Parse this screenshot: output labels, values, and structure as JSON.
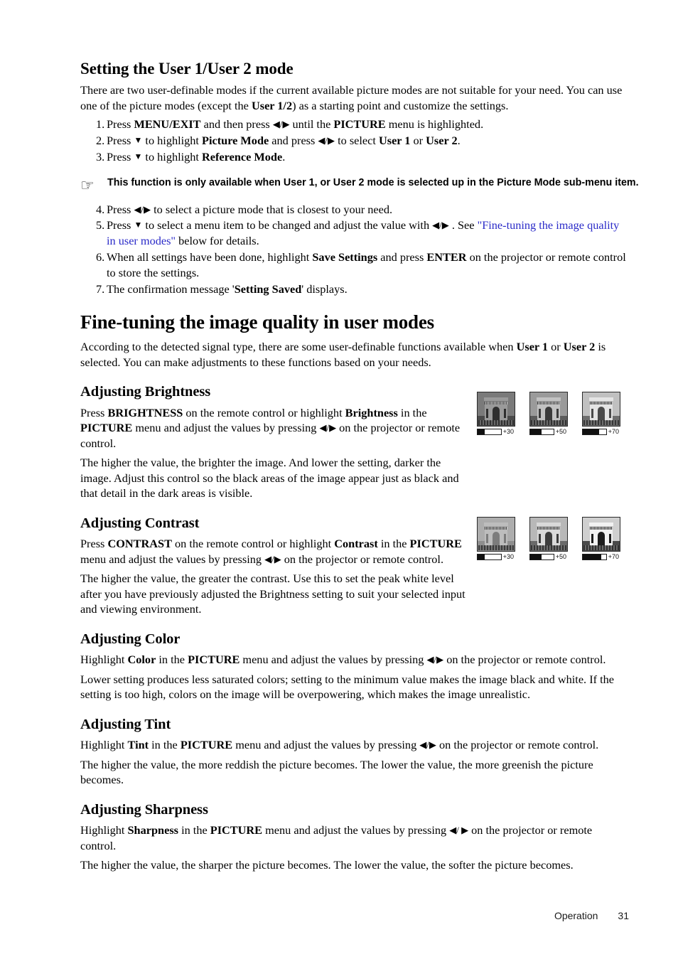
{
  "page": {
    "footer_label": "Operation",
    "footer_page_number": "31",
    "link_color": "#2a2ac8"
  },
  "section_user_mode": {
    "heading": "Setting the User 1/User 2 mode",
    "intro_part1": "There are two user-definable modes if the current available picture modes are not suitable for your need. You can use one of the picture modes (except the ",
    "intro_bold": "User 1/2",
    "intro_part2": ") as a starting point and customize the settings.",
    "steps": [
      {
        "num": "1.",
        "t1": "Press ",
        "b1": "MENU/EXIT",
        "t2": " and then press ",
        "arrows": "◀/▶",
        "t3": " until the ",
        "b2": "PICTURE",
        "t4": " menu is highlighted."
      },
      {
        "num": "2.",
        "t1": "Press ",
        "arrow_down": "▼",
        "t2": " to highlight ",
        "b1": "Picture Mode",
        "t3": " and press ",
        "arrows": "◀/▶",
        "t4": " to select ",
        "b2": "User 1",
        "t5": " or ",
        "b3": "User 2",
        "t6": "."
      },
      {
        "num": "3.",
        "t1": "Press ",
        "arrow_down": "▼",
        "t2": " to highlight ",
        "b1": "Reference Mode",
        "t3": "."
      }
    ],
    "note": {
      "icon": "pointing-hand-icon",
      "text": "This function is only available when User 1, or User 2 mode is selected up in the Picture Mode sub-menu item."
    },
    "steps2": [
      {
        "num": "4.",
        "t1": "Press ",
        "arrows": "◀/▶",
        "t2": " to select a picture mode that is closest to your need."
      },
      {
        "num": "5.",
        "t1": "Press ",
        "arrow_down": "▼",
        "t2": " to select a menu item to be changed and adjust the value with ",
        "arrows": "◀/▶",
        "t3": " . See ",
        "link": "\"Fine-tuning the image quality in user modes\"",
        "t4": " below for details."
      },
      {
        "num": "6.",
        "t1": "When all settings have been done, highlight ",
        "b1": "Save Settings",
        "t2": " and press ",
        "b2": "ENTER",
        "t3": " on the projector or remote control to store the settings."
      },
      {
        "num": "7.",
        "t1": "The confirmation message '",
        "b1": "Setting Saved",
        "t2": "' displays."
      }
    ]
  },
  "section_fine_tuning": {
    "heading": "Fine-tuning the image quality in user modes",
    "intro_t1": "According to the detected signal type, there are some user-definable functions available when ",
    "intro_b1": "User 1",
    "intro_t2": " or ",
    "intro_b2": "User 2",
    "intro_t3": " is selected. You can make adjustments to these functions based on your needs."
  },
  "brightness": {
    "heading": "Adjusting Brightness",
    "p1_t1": "Press ",
    "p1_b1": "BRIGHTNESS",
    "p1_t2": " on the remote control or highlight ",
    "p1_b2": "Brightness",
    "p1_t3": " in the ",
    "p1_b3": "PICTURE",
    "p1_t4": " menu and adjust the values by pressing ",
    "p1_arrows": "◀/▶",
    "p1_t5": " on the projector or remote control.",
    "p2": "The higher the value, the brighter the image. And lower the setting, darker the image. Adjust this control so the black areas of the image appear just as black and that detail in the dark areas is visible.",
    "samples": [
      {
        "value": "+30",
        "fill_percent": 30,
        "sky": "#7a7a7a",
        "ground": "#4a4a4a",
        "stone": "#9a9a9a",
        "shadow": "#2e2e2e"
      },
      {
        "value": "+50",
        "fill_percent": 50,
        "sky": "#9a9a9a",
        "ground": "#5c5c5c",
        "stone": "#c2c2c2",
        "shadow": "#3a3a3a"
      },
      {
        "value": "+70",
        "fill_percent": 70,
        "sky": "#c0c0c0",
        "ground": "#6e6e6e",
        "stone": "#e4e4e4",
        "shadow": "#4a4a4a"
      }
    ]
  },
  "contrast": {
    "heading": "Adjusting Contrast",
    "p1_t1": "Press ",
    "p1_b1": "CONTRAST",
    "p1_t2": " on the remote control or highlight ",
    "p1_b2": "Contrast",
    "p1_t3": " in the ",
    "p1_b3": "PICTURE",
    "p1_t4": " menu and adjust the values by pressing ",
    "p1_arrows": "◀/▶",
    "p1_t5": " on the projector or remote control.",
    "p2": "The higher the value, the greater the contrast. Use this to set the peak white level after you have previously adjusted the Brightness setting to suit your selected input and viewing environment.",
    "samples": [
      {
        "value": "+30",
        "fill_percent": 30,
        "sky": "#adadad",
        "ground": "#8e8e8e",
        "stone": "#bdbdbd",
        "shadow": "#7c7c7c"
      },
      {
        "value": "+50",
        "fill_percent": 50,
        "sky": "#b8b8b8",
        "ground": "#6a6a6a",
        "stone": "#dadada",
        "shadow": "#3c3c3c"
      },
      {
        "value": "+70",
        "fill_percent": 78,
        "sky": "#cfcfcf",
        "ground": "#4a4a4a",
        "stone": "#f2f2f2",
        "shadow": "#1c1c1c"
      }
    ]
  },
  "color": {
    "heading": "Adjusting Color",
    "p1_t1": "Highlight ",
    "p1_b1": "Color",
    "p1_t2": " in the ",
    "p1_b2": "PICTURE",
    "p1_t3": " menu and adjust the values by pressing ",
    "p1_arrows": "◀/▶",
    "p1_t4": " on the projector or remote control.",
    "p2": "Lower setting produces less saturated colors; setting to the minimum value makes the image black and white. If the setting is too high, colors on the image will be overpowering, which makes the image unrealistic."
  },
  "tint": {
    "heading": "Adjusting Tint",
    "p1_t1": "Highlight ",
    "p1_b1": "Tint",
    "p1_t2": " in the ",
    "p1_b2": "PICTURE",
    "p1_t3": " menu and adjust the values by pressing ",
    "p1_arrows": "◀/▶",
    "p1_t4": " on the projector or remote control.",
    "p2": "The higher the value, the more reddish the picture becomes. The lower the value, the more greenish the picture becomes."
  },
  "sharpness": {
    "heading": "Adjusting Sharpness",
    "p1_t1": "Highlight ",
    "p1_b1": "Sharpness",
    "p1_t2": " in the ",
    "p1_b2": "PICTURE",
    "p1_t3": " menu and adjust the values by pressing ",
    "p1_arrows": "◀/ ▶",
    "p1_t4": " on the projector or remote control.",
    "p2": "The higher the value, the sharper the picture becomes. The lower the value, the softer the picture becomes."
  }
}
